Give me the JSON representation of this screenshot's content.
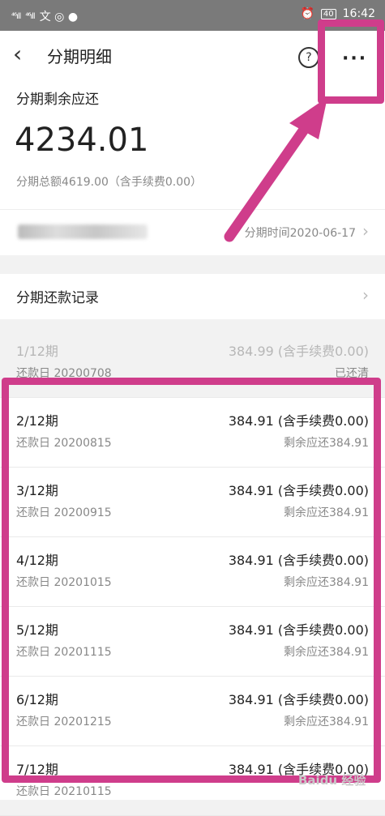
{
  "statusbar": {
    "signal1": "⁴⁶ıll",
    "signal2": "⁴⁶ıll",
    "icons_left": "文 ◎ ●",
    "alarm": "⏰",
    "battery": "40",
    "time": "16:42"
  },
  "header": {
    "back_icon": "‹",
    "title": "分期明细",
    "help_icon": "?",
    "more_icon": "···"
  },
  "summary": {
    "label": "分期剩余应还",
    "amount": "4234.01",
    "total": "分期总额4619.00（含手续费0.00）"
  },
  "info": {
    "time": "分期时间2020-06-17",
    "chevron": "›"
  },
  "records": {
    "label": "分期还款记录",
    "chevron": "›"
  },
  "installments": [
    {
      "period": "1/12期",
      "amount": "384.99 (含手续费0.00)",
      "date": "还款日 20200708",
      "status": "已还清"
    },
    {
      "period": "2/12期",
      "amount": "384.91 (含手续费0.00)",
      "date": "还款日 20200815",
      "status": "剩余应还384.91"
    },
    {
      "period": "3/12期",
      "amount": "384.91 (含手续费0.00)",
      "date": "还款日 20200915",
      "status": "剩余应还384.91"
    },
    {
      "period": "4/12期",
      "amount": "384.91 (含手续费0.00)",
      "date": "还款日 20201015",
      "status": "剩余应还384.91"
    },
    {
      "period": "5/12期",
      "amount": "384.91 (含手续费0.00)",
      "date": "还款日 20201115",
      "status": "剩余应还384.91"
    },
    {
      "period": "6/12期",
      "amount": "384.91 (含手续费0.00)",
      "date": "还款日 20201215",
      "status": "剩余应还384.91"
    },
    {
      "period": "7/12期",
      "amount": "384.91 (含手续费0.00)",
      "date": "还款日 20210115",
      "status": ""
    }
  ],
  "watermark": "Baidu 经验",
  "colors": {
    "highlight": "#cf3d8b",
    "status_bar": "#7a7a7a"
  }
}
